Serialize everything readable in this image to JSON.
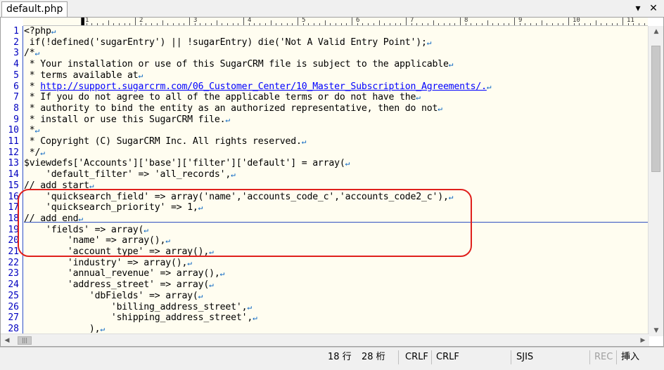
{
  "tab": {
    "title": "default.php"
  },
  "window": {
    "minimize_label": "▾",
    "close_label": "✕"
  },
  "ruler": {
    "marks": [
      "1",
      "2",
      "3",
      "4",
      "5",
      "6",
      "7",
      "8",
      "9",
      "10",
      "11"
    ]
  },
  "editor": {
    "lines": [
      {
        "n": "1",
        "text": "<?php"
      },
      {
        "n": "2",
        "text": " if(!defined('sugarEntry') || !sugarEntry) die('Not A Valid Entry Point');"
      },
      {
        "n": "3",
        "text": "/*"
      },
      {
        "n": "4",
        "text": " * Your installation or use of this SugarCRM file is subject to the applicable"
      },
      {
        "n": "5",
        "text": " * terms available at"
      },
      {
        "n": "6",
        "text": " * ",
        "link": "http://support.sugarcrm.com/06_Customer_Center/10_Master_Subscription_Agreements/."
      },
      {
        "n": "7",
        "text": " * If you do not agree to all of the applicable terms or do not have the"
      },
      {
        "n": "8",
        "text": " * authority to bind the entity as an authorized representative, then do not"
      },
      {
        "n": "9",
        "text": " * install or use this SugarCRM file."
      },
      {
        "n": "10",
        "text": " *"
      },
      {
        "n": "11",
        "text": " * Copyright (C) SugarCRM Inc. All rights reserved."
      },
      {
        "n": "12",
        "text": " */"
      },
      {
        "n": "13",
        "text": "$viewdefs['Accounts']['base']['filter']['default'] = array("
      },
      {
        "n": "14",
        "text": "    'default_filter' => 'all_records',"
      },
      {
        "n": "15",
        "text": "// add start"
      },
      {
        "n": "16",
        "text": "    'quicksearch_field' => array('name','accounts_code_c','accounts_code2_c'),"
      },
      {
        "n": "17",
        "text": "    'quicksearch_priority' => 1,"
      },
      {
        "n": "18",
        "text": "// add end"
      },
      {
        "n": "19",
        "text": "    'fields' => array("
      },
      {
        "n": "20",
        "text": "        'name' => array(),"
      },
      {
        "n": "21",
        "text": "        'account_type' => array(),"
      },
      {
        "n": "22",
        "text": "        'industry' => array(),"
      },
      {
        "n": "23",
        "text": "        'annual_revenue' => array(),"
      },
      {
        "n": "24",
        "text": "        'address_street' => array("
      },
      {
        "n": "25",
        "text": "            'dbFields' => array("
      },
      {
        "n": "26",
        "text": "                'billing_address_street',"
      },
      {
        "n": "27",
        "text": "                'shipping_address_street',"
      },
      {
        "n": "28",
        "text": "            ),"
      }
    ],
    "eol_mark": "↵"
  },
  "status": {
    "line": "18 行",
    "column": "28 桁",
    "newline1": "CRLF",
    "newline2": "CRLF",
    "encoding": "SJIS",
    "rec": "REC",
    "insert_mode": "挿入"
  },
  "colors": {
    "annotation": "#e0201c",
    "line_number": "#0000c0",
    "eol": "#0060c0",
    "editor_bg": "#fffdf0"
  }
}
